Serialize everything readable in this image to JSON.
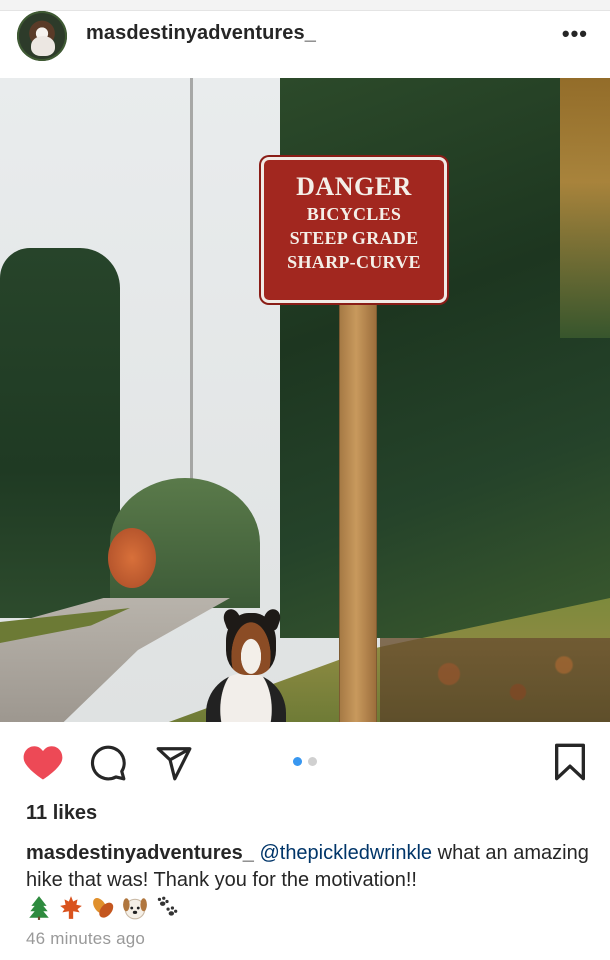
{
  "post": {
    "username": "masdestinyadventures_",
    "more_icon": "more-horizontal-icon"
  },
  "photo": {
    "sign_lines": [
      "DANGER",
      "BICYCLES",
      "STEEP GRADE",
      "SHARP-CURVE"
    ]
  },
  "actions": {
    "like_icon": "heart-icon",
    "like_color": "#ed4956",
    "comment_icon": "comment-icon",
    "share_icon": "send-icon",
    "save_icon": "bookmark-icon",
    "carousel_active_color": "#3897f0",
    "carousel_page": "1 of 2"
  },
  "likes": "11 likes",
  "caption": {
    "username": "masdestinyadventures_",
    "mention": "@thepickledwrinkle",
    "text": "what an amazing hike that was! Thank you for the motivation!!",
    "emojis": [
      "evergreen-tree-emoji",
      "maple-leaf-emoji",
      "fallen-leaf-emoji",
      "dog-face-emoji",
      "paw-prints-emoji"
    ]
  },
  "timestamp": "46 minutes ago"
}
